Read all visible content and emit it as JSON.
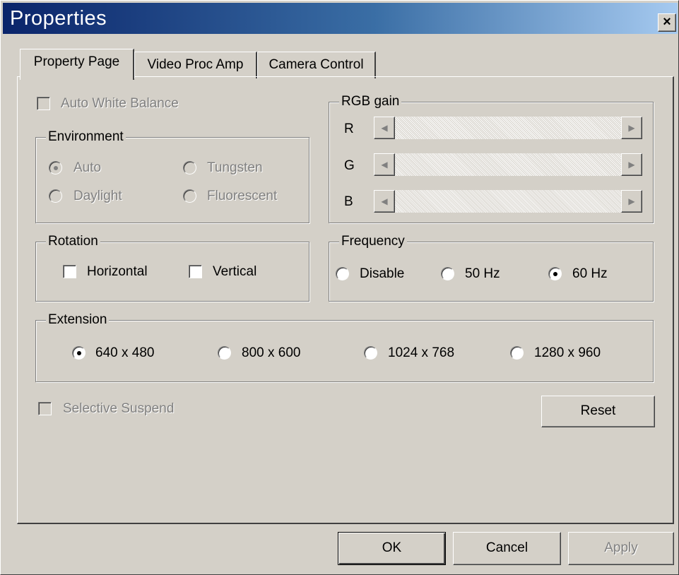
{
  "window": {
    "title": "Properties",
    "close_label": "×"
  },
  "tabs": [
    {
      "label": "Property Page",
      "active": true
    },
    {
      "label": "Video Proc Amp",
      "active": false
    },
    {
      "label": "Camera Control",
      "active": false
    }
  ],
  "auto_white_balance": {
    "label": "Auto White Balance",
    "checked": false,
    "enabled": false
  },
  "environment": {
    "title": "Environment",
    "options": [
      {
        "label": "Auto",
        "selected": true
      },
      {
        "label": "Tungsten",
        "selected": false
      },
      {
        "label": "Daylight",
        "selected": false
      },
      {
        "label": "Fluorescent",
        "selected": false
      }
    ],
    "enabled": false
  },
  "rgb_gain": {
    "title": "RGB gain",
    "channels": [
      {
        "label": "R"
      },
      {
        "label": "G"
      },
      {
        "label": "B"
      }
    ],
    "left_arrow": "◀",
    "right_arrow": "▶"
  },
  "rotation": {
    "title": "Rotation",
    "horizontal": {
      "label": "Horizontal",
      "checked": false
    },
    "vertical": {
      "label": "Vertical",
      "checked": false
    }
  },
  "frequency": {
    "title": "Frequency",
    "options": [
      {
        "label": "Disable",
        "selected": false
      },
      {
        "label": "50 Hz",
        "selected": false
      },
      {
        "label": "60 Hz",
        "selected": true
      }
    ]
  },
  "extension": {
    "title": "Extension",
    "options": [
      {
        "label": "640 x 480",
        "selected": true
      },
      {
        "label": "800 x 600",
        "selected": false
      },
      {
        "label": "1024 x 768",
        "selected": false
      },
      {
        "label": "1280 x 960",
        "selected": false
      }
    ]
  },
  "selective_suspend": {
    "label": "Selective Suspend",
    "checked": false,
    "enabled": false
  },
  "reset_button": {
    "label": "Reset"
  },
  "footer": {
    "ok_label": "OK",
    "cancel_label": "Cancel",
    "apply_label": "Apply",
    "apply_enabled": false
  },
  "colors": {
    "face": "#d4d0c8",
    "title_gradient_start": "#0a246a",
    "title_gradient_end": "#a6caf0",
    "disabled_text": "#808080"
  }
}
